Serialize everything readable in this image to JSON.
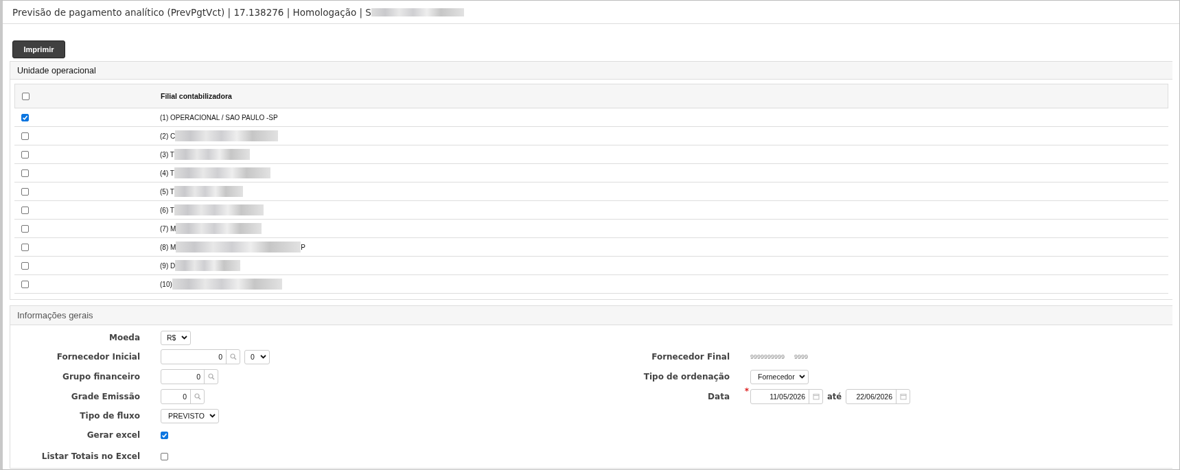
{
  "window": {
    "title": "Previsão de pagamento analítico (PrevPgtVct) | 17.138276 | Homologação | S",
    "redacted": true
  },
  "print_button": "Imprimir",
  "unit_panel": {
    "title": "Unidade operacional",
    "header_checked": false,
    "column": "Filial contabilizadora",
    "rows": [
      {
        "label": "(1) OPERACIONAL / SAO PAULO -SP",
        "checked": true,
        "redacted": false
      },
      {
        "label": "(2) C",
        "checked": false,
        "redacted": true
      },
      {
        "label": "(3) T",
        "checked": false,
        "redacted": true
      },
      {
        "label": "(4) T",
        "checked": false,
        "redacted": true
      },
      {
        "label": "(5) T",
        "checked": false,
        "redacted": true
      },
      {
        "label": "(6) T",
        "checked": false,
        "redacted": true
      },
      {
        "label": "(7) M",
        "checked": false,
        "redacted": true
      },
      {
        "label": "(8) M",
        "checked": false,
        "redacted": true,
        "tail": "P"
      },
      {
        "label": "(9) D",
        "checked": false,
        "redacted": true
      },
      {
        "label": "(10)",
        "checked": false,
        "redacted": true
      }
    ]
  },
  "general_panel": {
    "title": "Informações gerais",
    "left": [
      {
        "kind": "select",
        "label": "Moeda",
        "value": "R$"
      },
      {
        "kind": "lookup",
        "label": "Fornecedor Inicial",
        "value": "0",
        "select": "0"
      },
      {
        "kind": "lookup",
        "label": "Grupo financeiro",
        "value": "0"
      },
      {
        "kind": "lookup",
        "label": "Grade Emissão",
        "value": "0"
      },
      {
        "kind": "select",
        "label": "Tipo de fluxo",
        "value": "PREVISTO"
      },
      {
        "kind": "checkbox",
        "label": "Gerar excel",
        "checked": true
      },
      {
        "kind": "checkbox",
        "label": "Listar Totais no Excel",
        "checked": false
      }
    ],
    "right": [
      {
        "kind": "text",
        "label": "Fornecedor Final",
        "values": [
          "9999999999",
          "9999"
        ]
      },
      {
        "kind": "select",
        "label": "Tipo de ordenação",
        "value": "Fornecedor"
      },
      {
        "kind": "daterange",
        "label": "Data",
        "required_mark": "*",
        "from": "11/05/2026",
        "separator": "até",
        "to": "22/06/2026"
      }
    ]
  }
}
